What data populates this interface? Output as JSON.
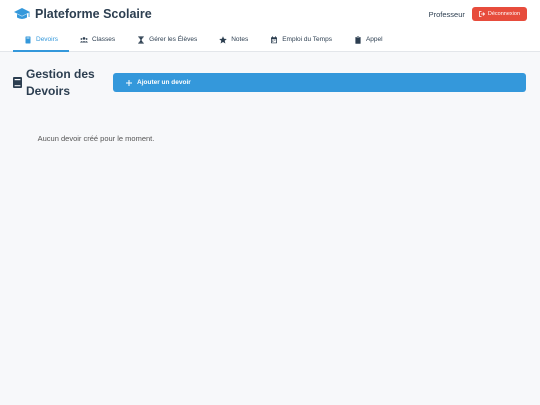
{
  "header": {
    "title": "Plateforme Scolaire",
    "role": "Professeur",
    "logout_label": "Déconnexion"
  },
  "nav": {
    "tabs": [
      {
        "label": "Devoirs",
        "icon": "book-icon",
        "active": true
      },
      {
        "label": "Classes",
        "icon": "users-icon",
        "active": false
      },
      {
        "label": "Gérer les Élèves",
        "icon": "hourglass-icon",
        "active": false
      },
      {
        "label": "Notes",
        "icon": "star-icon",
        "active": false
      },
      {
        "label": "Emploi du Temps",
        "icon": "calendar-icon",
        "active": false
      },
      {
        "label": "Appel",
        "icon": "clipboard-icon",
        "active": false
      }
    ]
  },
  "main": {
    "title": "Gestion des Devoirs",
    "add_button_label": "Ajouter un devoir",
    "empty_message": "Aucun devoir créé pour le moment."
  },
  "colors": {
    "primary": "#3498db",
    "danger": "#e74c3c",
    "text": "#2c3e50",
    "background": "#f7f8fa"
  }
}
